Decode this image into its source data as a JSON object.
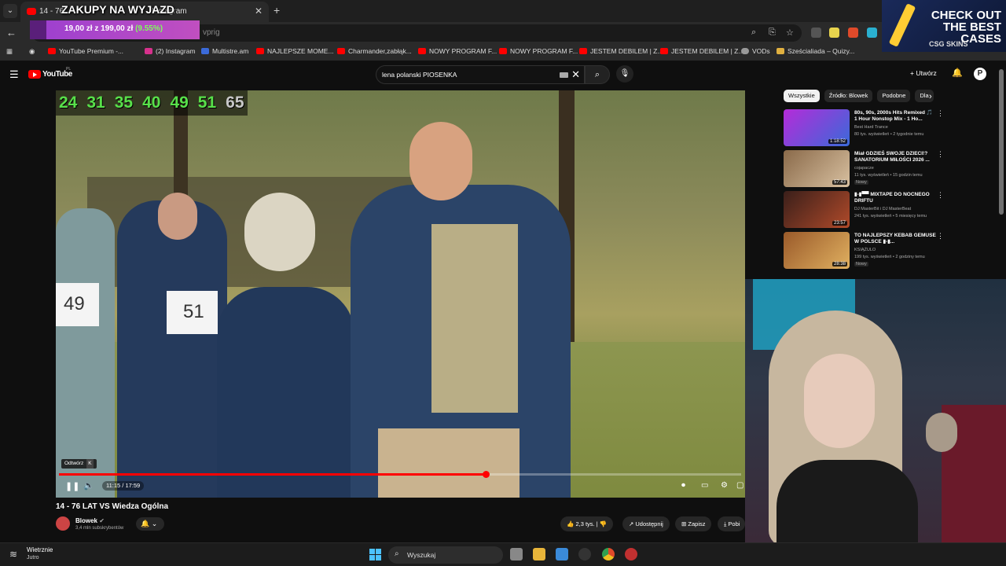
{
  "browser": {
    "tab_title": "14 - 76",
    "tab_title_tail": "Instagram",
    "url": "vprig",
    "bookmarks": [
      "YouTube Premium -...",
      "(2) Instagram",
      "Multistre.am",
      "NAJLEPSZE MOME...",
      "Charmander,zabłąk...",
      "NOWY PROGRAM F...",
      "NOWY PROGRAM F...",
      "JESTEM DEBILEM | Z...",
      "JESTEM DEBILEM | Z...",
      "VODs",
      "Sześcialiada – Quizy..."
    ]
  },
  "overlay": {
    "goal_title": "ZAKUPY NA WYJAZD",
    "goal_amount": "19,00 zł z 199,00 zł",
    "goal_percent": "(9.55%)",
    "goal_progress": 0.0955,
    "promo_line1": "CHECK OUT THE BEST CASES",
    "promo_line2": "CSG SKINS"
  },
  "youtube": {
    "logo": "YouTube",
    "region": "PL",
    "search_value": "lena polanski PIOSENKA",
    "create_label": "Utwórz",
    "avatar_letter": "P"
  },
  "video": {
    "numbers": [
      "24",
      "31",
      "35",
      "40",
      "49",
      "51",
      "65"
    ],
    "sign_left": "49",
    "sign_mid": "51",
    "tooltip_label": "Odtwórz",
    "tooltip_key": "K",
    "time": "11:15 / 17:59",
    "progress": 0.626,
    "title": "14 - 76 LAT VS Wiedza Ogólna",
    "channel": "Blowek",
    "subscribers": "3,4 mln subskrybentów",
    "likes": "2,3 tys.",
    "share_label": "Udostępnij",
    "save_label": "Zapisz",
    "download_label": "Pobi"
  },
  "sidebar": {
    "chips": [
      "Wszystkie",
      "Źródło: Blowek",
      "Podobne",
      "Dla"
    ],
    "recs": [
      {
        "title": "80s, 90s, 2000s Hits Remixed 🎵 1 Hour Nonstop Mix - 1 Ho...",
        "channel": "Best Hard Trance",
        "meta": "80 tys. wyświetleń • 2 tygodnie temu",
        "duration": "1:18:52",
        "new": "",
        "color": "#b52bd9"
      },
      {
        "title": "Miał GDZIEŚ SWOJE DZIECI!? SANATORIUM MIŁOŚCI 2026 ...",
        "channel": "cojapacze",
        "meta": "11 tys. wyświetleń • 15 godzin temu",
        "duration": "57:43",
        "new": "Nowy",
        "color": "#8a6a4a"
      },
      {
        "title": "▮-▮▀▀ MIXTAPE DO NOCNEGO DRIFTU",
        "channel": "DJ MasterBit i DJ MasterBeat",
        "meta": "241 tys. wyświetleń • 5 miesięcy temu",
        "duration": "23:57",
        "new": "",
        "color": "#3a1f1a"
      },
      {
        "title": "TO NAJLEPSZY KEBAB GEMUSE W POLSCE ▮-▮...",
        "channel": "KSIĄŻULO",
        "meta": "199 tys. wyświetleń • 2 godziny temu",
        "duration": "28:38",
        "new": "Nowy",
        "color": "#9a5a2a"
      }
    ]
  },
  "taskbar": {
    "weather_title": "Wietrznie",
    "weather_sub": "Jutro",
    "search_label": "Wyszukaj"
  }
}
